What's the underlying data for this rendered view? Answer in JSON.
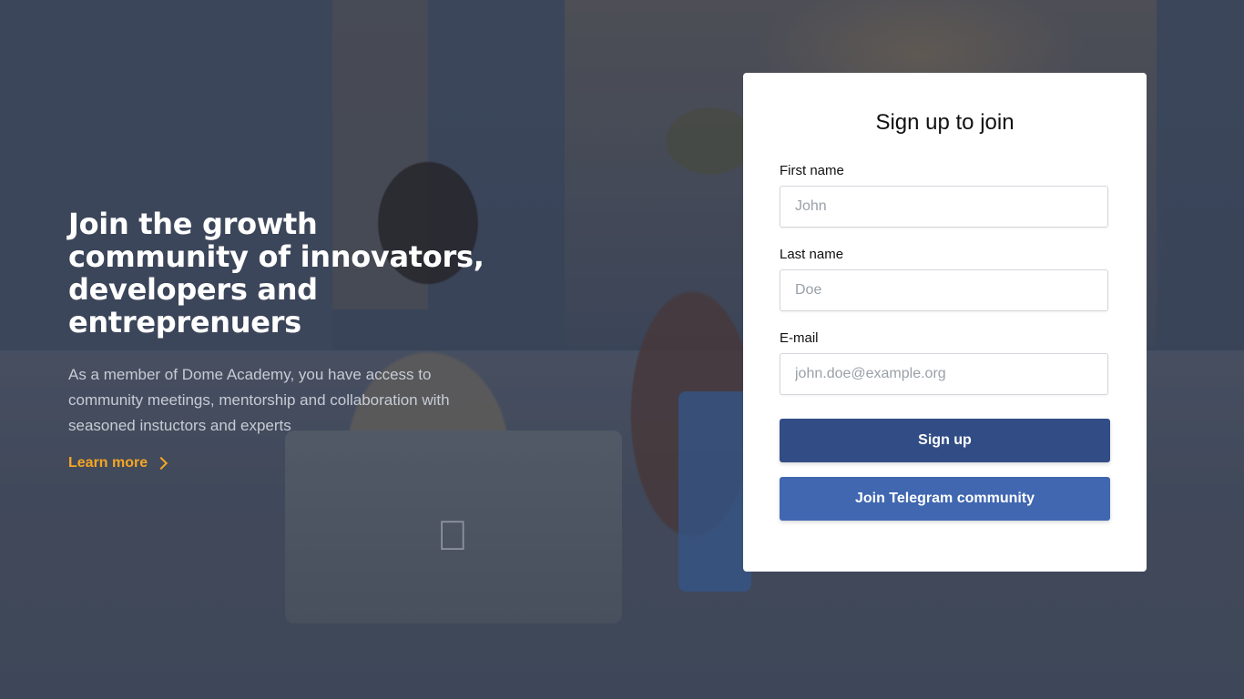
{
  "hero": {
    "title_line1": "Join the growth",
    "title_line2": "community of innovators,",
    "title_line3": "developers and entreprenuers",
    "description": "As a member of Dome Academy, you have access to community meetings, mentorship and collaboration with seasoned instuctors and experts",
    "learn_more": "Learn more"
  },
  "form": {
    "title": "Sign up to join",
    "first_name": {
      "label": "First name",
      "placeholder": "John",
      "value": ""
    },
    "last_name": {
      "label": "Last name",
      "placeholder": "Doe",
      "value": ""
    },
    "email": {
      "label": "E-mail",
      "placeholder": "john.doe@example.org",
      "value": ""
    },
    "signup_button": "Sign up",
    "telegram_button": "Join Telegram community"
  },
  "colors": {
    "accent": "#f5a623",
    "signup_button_bg": "#324d86",
    "telegram_button_bg": "#4067b0",
    "card_bg": "#ffffff"
  },
  "icons": {
    "learn_more": "chevron-right-icon"
  }
}
